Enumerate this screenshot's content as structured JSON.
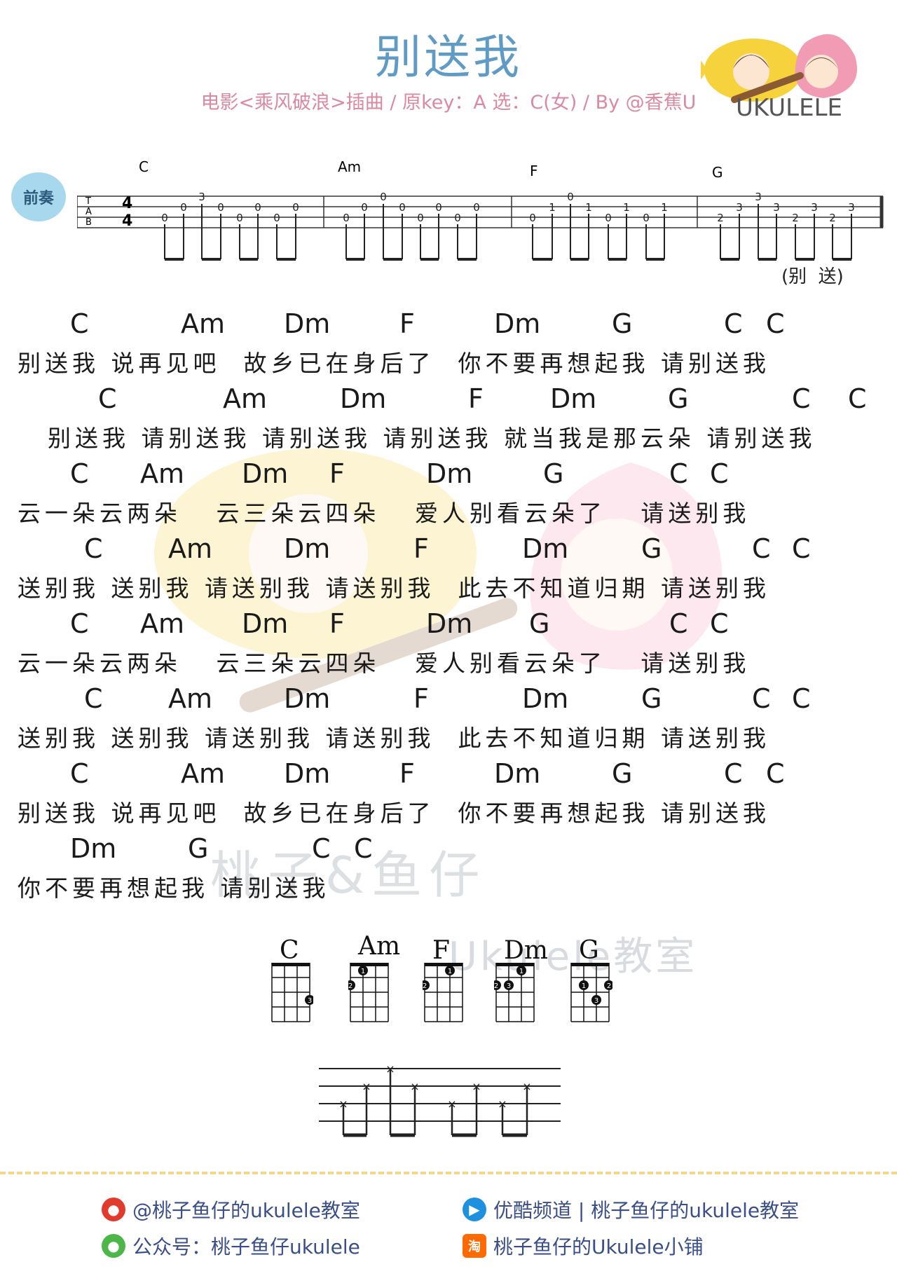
{
  "header": {
    "title": "别送我",
    "subtitle": "电影<乘风破浪>插曲 / 原key：A 选：C(女) / By @香蕉U",
    "logo_text": "UKULELE"
  },
  "intro": {
    "label": "前奏",
    "chords": [
      "C",
      "Am",
      "F",
      "G"
    ],
    "lyric_hint": "(别  送)"
  },
  "lines": [
    {
      "chords": [
        "C",
        "Am",
        "Dm",
        "F",
        "Dm",
        "G",
        "C",
        "C"
      ],
      "text": "别送我 说再见吧  故乡已在身后了  你不要再想起我 请别送我"
    },
    {
      "chords": [
        "C",
        "Am",
        "Dm",
        "F",
        "Dm",
        "G",
        "C",
        "C"
      ],
      "text": "别送我 请别送我 请别送我 请别送我 就当我是那云朵 请别送我"
    },
    {
      "chords": [
        "C",
        "Am",
        "Dm",
        "F",
        "Dm",
        "G",
        "C",
        "C"
      ],
      "text": "云一朵云两朵   云三朵云四朵   爱人别看云朵了   请送别我"
    },
    {
      "chords": [
        "C",
        "Am",
        "Dm",
        "F",
        "Dm",
        "G",
        "C",
        "C"
      ],
      "text": "送别我 送别我 请送别我 请送别我  此去不知道归期 请送别我"
    },
    {
      "chords": [
        "C",
        "Am",
        "Dm",
        "F",
        "Dm",
        "G",
        "C",
        "C"
      ],
      "text": "云一朵云两朵   云三朵云四朵   爱人别看云朵了   请送别我"
    },
    {
      "chords": [
        "C",
        "Am",
        "Dm",
        "F",
        "Dm",
        "G",
        "C",
        "C"
      ],
      "text": "送别我 送别我 请送别我 请送别我  此去不知道归期 请送别我"
    },
    {
      "chords": [
        "C",
        "Am",
        "Dm",
        "F",
        "Dm",
        "G",
        "C",
        "C"
      ],
      "text": "别送我 说再见吧  故乡已在身后了  你不要再想起我 请别送我"
    },
    {
      "chords": [
        "Dm",
        "G",
        "C",
        "C"
      ],
      "text": "你不要再想起我 请别送我"
    }
  ],
  "chord_diagrams": [
    "C",
    "Am",
    "F",
    "Dm",
    "G"
  ],
  "watermark": {
    "brand": "桃子&鱼仔",
    "class": "Ukulele教室"
  },
  "footer": {
    "weibo": "@桃子鱼仔的ukulele教室",
    "youku": "优酷频道 | 桃子鱼仔的ukulele教室",
    "wechat": "公众号：桃子鱼仔ukulele",
    "taobao": "桃子鱼仔的Ukulele小铺",
    "taobao_icon": "淘"
  },
  "colors": {
    "title": "#5f9bc4",
    "subtitle": "#d98aa0",
    "dash": "#f3d78a",
    "footer_text": "#3a4f8a"
  }
}
